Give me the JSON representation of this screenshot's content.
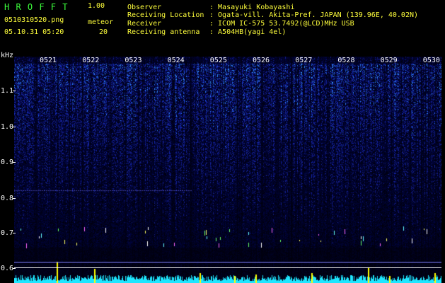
{
  "app": {
    "title": "H R O F F T",
    "version": "1.00",
    "file": "0510310520.png",
    "datetime": "05.10.31 05:20",
    "meteor_label": "meteor",
    "meteor_count": "20"
  },
  "info": {
    "observer_label": "Observer",
    "observer_value": ": Masayuki Kobayashi",
    "location_label": "Receiving Location",
    "location_value": ": Ogata-vill. Akita-Pref. JAPAN (139.96E, 40.02N)",
    "receiver_label": "Receiver",
    "receiver_value": ": ICOM IC-575 53.7492(@LCD)MHz USB",
    "antenna_label": "Receiving antenna",
    "antenna_value": ": A504HB(yagi 4el)"
  },
  "chart_data": {
    "type": "heatmap",
    "yunit": "kHz",
    "yticks": [
      "1.1",
      "1.0",
      "0.9",
      "0.8",
      "0.7",
      "0.6"
    ],
    "xticks": [
      "0521",
      "0522",
      "0523",
      "0524",
      "0525",
      "0526",
      "0527",
      "0528",
      "0529",
      "0530"
    ],
    "ylim": [
      0.58,
      1.18
    ],
    "colors": {
      "background": "#000000",
      "noise": "#1a3cff",
      "signal": "#ffff00",
      "baseline": "#00ffff"
    }
  }
}
